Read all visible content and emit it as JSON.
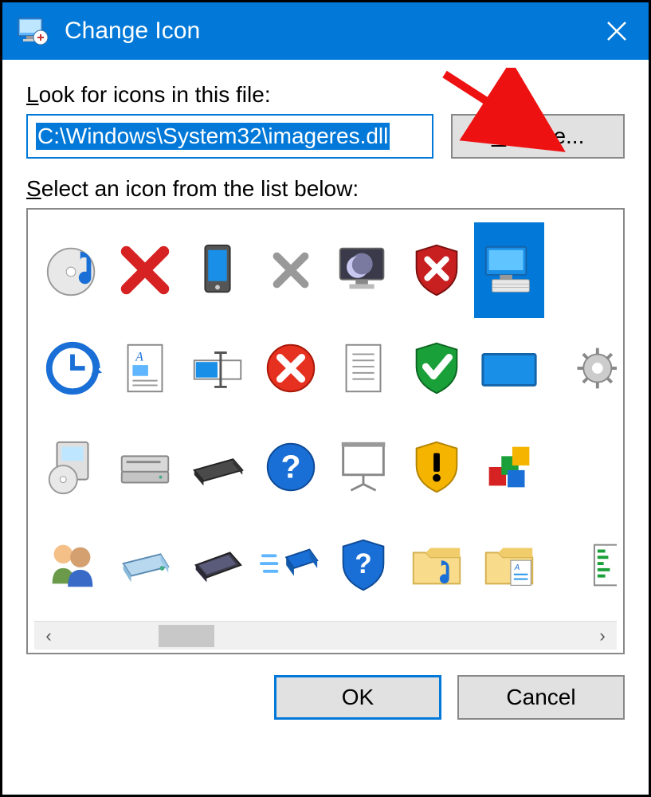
{
  "title": "Change Icon",
  "labels": {
    "look_for": "Look for icons in this file:",
    "select_icon": "Select an icon from the list below:"
  },
  "path_input": {
    "value": "C:\\Windows\\System32\\imageres.dll",
    "selected": true
  },
  "buttons": {
    "browse": "Browse...",
    "ok": "OK",
    "cancel": "Cancel"
  },
  "icons": [
    {
      "name": "music-disc-icon"
    },
    {
      "name": "red-x-icon"
    },
    {
      "name": "phone-device-icon"
    },
    {
      "name": "gray-x-icon"
    },
    {
      "name": "monitor-moon-icon"
    },
    {
      "name": "shield-x-icon"
    },
    {
      "name": "computer-icon",
      "selected": true
    },
    {
      "name": "cutoff-1"
    },
    {
      "name": "clock-arrow-icon"
    },
    {
      "name": "document-a-icon"
    },
    {
      "name": "rename-box-icon"
    },
    {
      "name": "circle-x-red-icon"
    },
    {
      "name": "document-lines-icon"
    },
    {
      "name": "shield-check-icon"
    },
    {
      "name": "widescreen-icon"
    },
    {
      "name": "gear-cutoff-icon"
    },
    {
      "name": "disc-box-icon"
    },
    {
      "name": "drive-bay-icon"
    },
    {
      "name": "scanner-icon"
    },
    {
      "name": "help-circle-icon"
    },
    {
      "name": "projector-screen-icon"
    },
    {
      "name": "shield-warning-icon"
    },
    {
      "name": "color-blocks-icon"
    },
    {
      "name": "cutoff-3"
    },
    {
      "name": "people-icon"
    },
    {
      "name": "hard-drive-icon"
    },
    {
      "name": "tablet-dark-icon"
    },
    {
      "name": "chip-fast-icon"
    },
    {
      "name": "shield-help-icon"
    },
    {
      "name": "folder-music-icon"
    },
    {
      "name": "folder-document-icon"
    },
    {
      "name": "green-bars-cutoff-icon"
    }
  ],
  "annotation": {
    "arrow_points_to": "browse-button"
  }
}
